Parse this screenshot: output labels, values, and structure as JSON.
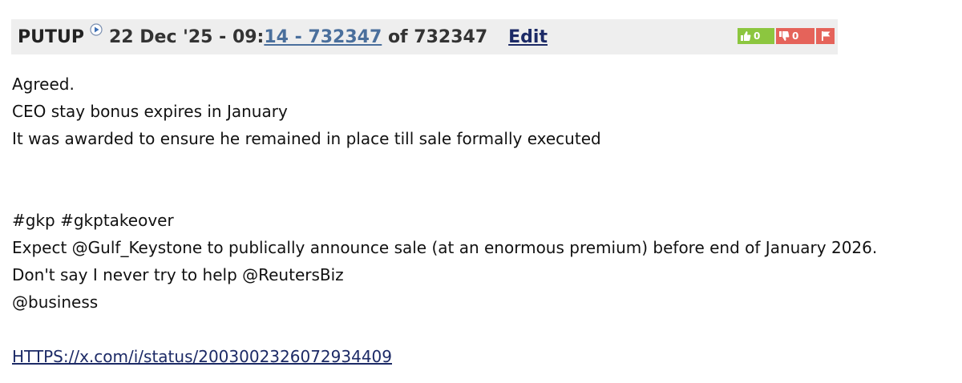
{
  "post": {
    "username": "PUTUP",
    "date_prefix": "22 Dec '25 - 09:",
    "time_link": "14 - 732347",
    "of_text": " of 732347",
    "edit_label": "Edit",
    "thumbs_up_count": "0",
    "thumbs_down_count": "0",
    "body": {
      "line1": "Agreed.",
      "line2": "CEO stay bonus expires in January",
      "line3": "It was awarded to ensure he remained in place till sale formally executed",
      "line4": "#gkp #gkptakeover",
      "line5": "Expect @Gulf_Keystone to publically announce sale (at an enormous premium) before end of January 2026.",
      "line6": "Don't say I never try to help @ReutersBiz",
      "line7": "@business",
      "link_text": "HTTPS://x.com/i/status/2003002326072934409"
    }
  },
  "colors": {
    "header_bg": "#eeeeee",
    "thumbs_up_bg": "#8cc63f",
    "thumbs_down_bg": "#e5635a",
    "link": "#1c2a66"
  }
}
